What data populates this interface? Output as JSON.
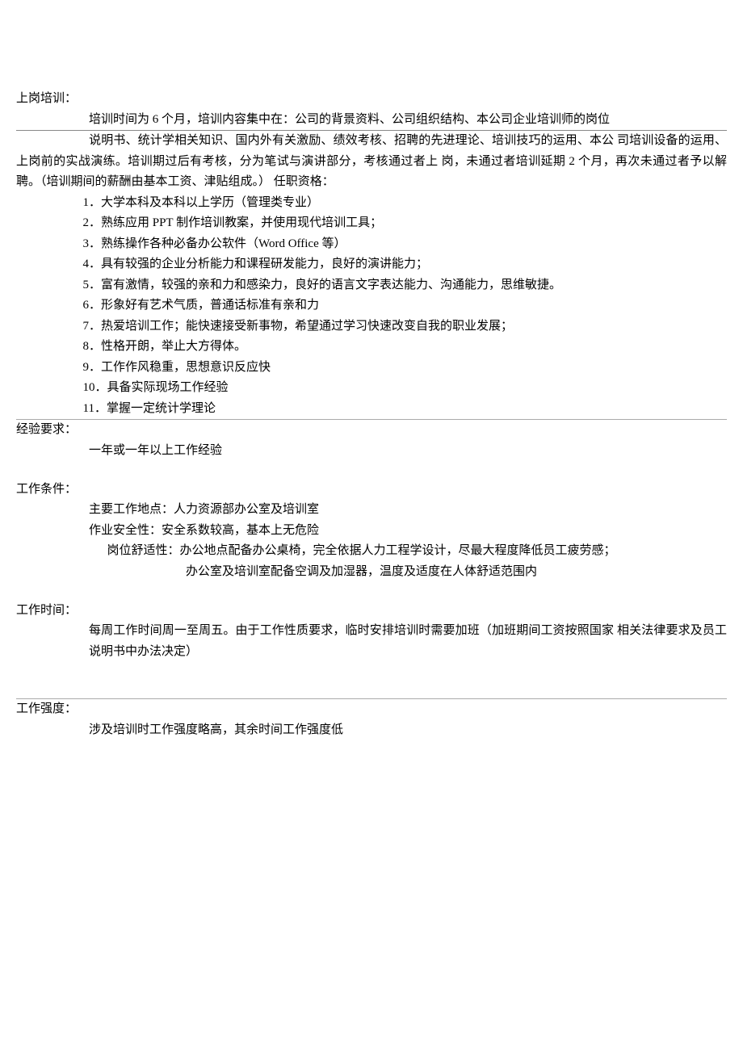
{
  "sections": {
    "shangganPeixun": {
      "title": "上岗培训：",
      "line1": "培训时间为 6 个月，培训内容集中在：公司的背景资料、公司组织结构、本公司企业培训师的岗位",
      "para2": "说明书、统计学相关知识、国内外有关激励、绩效考核、招聘的先进理论、培训技巧的运用、本公 司培训设备的运用、上岗前的实战演练。培训期过后有考核，分为笔试与演讲部分，考核通过者上 岗，未通过者培训延期 2 个月，再次未通过者予以解聘。（培训期间的薪酬由基本工资、津贴组成。） 任职资格：",
      "items": [
        "1．大学本科及本科以上学历（管理类专业）",
        "2．熟练应用 PPT 制作培训教案，并使用现代培训工具；",
        "3．熟练操作各种必备办公软件（Word Office 等）",
        "4．具有较强的企业分析能力和课程研发能力，良好的演讲能力；",
        "5．富有激情，较强的亲和力和感染力，良好的语言文字表达能力、沟通能力，思维敏捷。",
        "6．形象好有艺术气质，普通话标准有亲和力",
        "7．热爱培训工作；能快速接受新事物，希望通过学习快速改变自我的职业发展；",
        "8．性格开朗，举止大方得体。",
        "9．工作作风稳重，思想意识反应快",
        "10．具备实际现场工作经验",
        "11．掌握一定统计学理论"
      ]
    },
    "jingyan": {
      "title": "经验要求：",
      "content": "一年或一年以上工作经验"
    },
    "gongzuoTiaojian": {
      "title": "工作条件：",
      "line1": "主要工作地点：人力资源部办公室及培训室",
      "line2": "作业安全性：安全系数较高，基本上无危险",
      "line3": "岗位舒适性：办公地点配备办公桌椅，完全依据人力工程学设计，尽最大程度降低员工疲劳感；",
      "line4": "办公室及培训室配备空调及加湿器，温度及适度在人体舒适范围内"
    },
    "gongzuoShijian": {
      "title": "工作时间：",
      "content": "每周工作时间周一至周五。由于工作性质要求，临时安排培训时需要加班（加班期间工资按照国家 相关法律要求及员工说明书中办法决定）"
    },
    "gongzuoQiangdu": {
      "title": "工作强度：",
      "content": "涉及培训时工作强度略高，其余时间工作强度低"
    }
  }
}
